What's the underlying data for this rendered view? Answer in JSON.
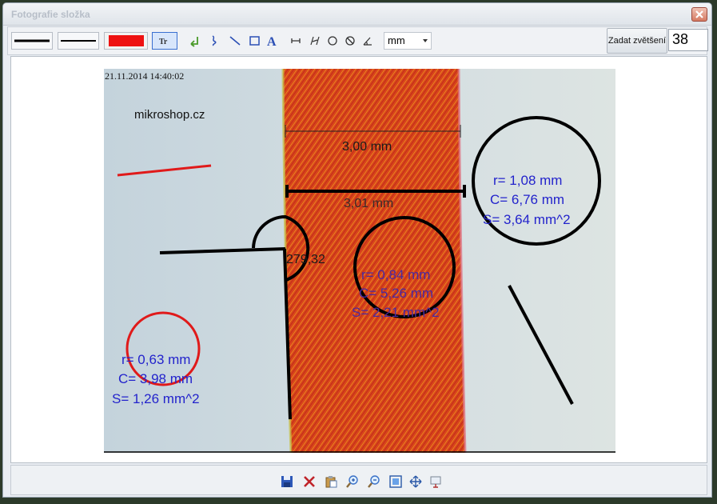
{
  "window": {
    "title": "Fotografie složka"
  },
  "toolbar": {
    "tools": [
      {
        "name": "line-thick-sample",
        "icon": "thick-line"
      },
      {
        "name": "line-thin-sample",
        "icon": "thin-line"
      },
      {
        "name": "color-sample",
        "icon": "red-color-swatch"
      },
      {
        "name": "text-style-tool",
        "icon": "text-style-icon"
      },
      {
        "name": "arrow-tool",
        "icon": "arrow-icon"
      },
      {
        "name": "freehand-tool",
        "icon": "freehand-icon"
      },
      {
        "name": "line-tool",
        "icon": "line-icon"
      },
      {
        "name": "rectangle-tool",
        "icon": "rectangle-icon"
      },
      {
        "name": "text-tool",
        "icon": "text-icon"
      },
      {
        "name": "measure-length-tool",
        "icon": "length-icon"
      },
      {
        "name": "measure-parallel-tool",
        "icon": "parallel-icon"
      },
      {
        "name": "measure-circle-tool",
        "icon": "circle-icon"
      },
      {
        "name": "measure-circle-diameter-tool",
        "icon": "circle-diameter-icon"
      },
      {
        "name": "measure-angle-tool",
        "icon": "angle-icon"
      }
    ],
    "unit": "mm",
    "zoom_label": "Zadat zvětšení",
    "zoom_value": "38",
    "accent_color": "#ee1111"
  },
  "photo": {
    "timestamp": "21.11.2014 14:40:02",
    "watermark": "mikroshop.cz",
    "measure1": "3,00 mm",
    "measure2": "3,01 mm",
    "angle": "279,32",
    "circle_large": {
      "r": "r= 1,08 mm",
      "c": "C= 6,76 mm",
      "s": "S= 3,64 mm^2"
    },
    "circle_mid": {
      "r": "r= 0,84 mm",
      "c": "C= 5,26 mm",
      "s": "S= 2,21 mm^2"
    },
    "circle_red": {
      "r": "r= 0,63 mm",
      "c": "C= 3,98 mm",
      "s": "S= 1,26 mm^2"
    }
  },
  "bottombar": {
    "icons": [
      "save-icon",
      "delete-icon",
      "paste-icon",
      "zoom-in-icon",
      "zoom-out-icon",
      "fit-icon",
      "move-icon",
      "export-icon"
    ]
  }
}
